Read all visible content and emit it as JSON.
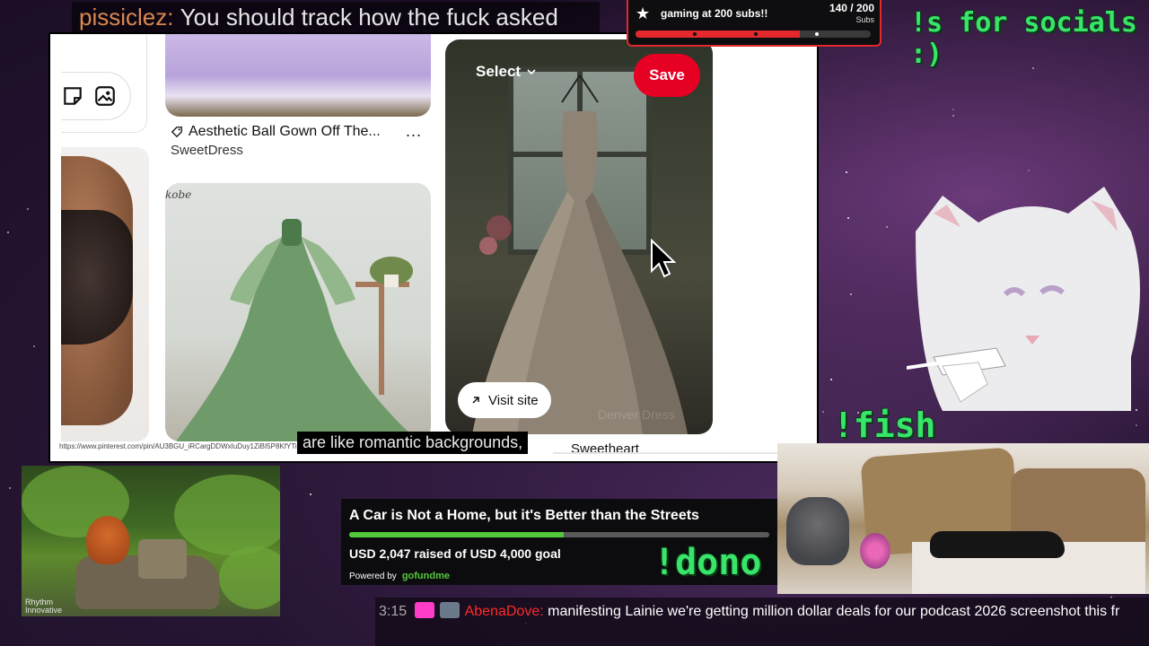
{
  "top_chat": {
    "user": "pissiclez:",
    "message": "You should track how the fuck asked"
  },
  "subs_goal": {
    "title": "gaming at 200 subs!!",
    "count": "140 / 200",
    "label": "Subs",
    "progress": 0.7,
    "accent": "#e3282e"
  },
  "overlays": {
    "socials": "!s for socials :)",
    "fish": "!fish",
    "dono": "!dono"
  },
  "pinterest": {
    "pin1_title": "Aesthetic Ball Gown Off The...",
    "pin1_more": "...",
    "pin1_source": "SweetDress",
    "pin2_brand": "kobe",
    "pin3_select": "Select",
    "pin3_save": "Save",
    "pin3_visit": "Visit site",
    "pin3_watermark": "Denver Dress",
    "next_title": "Sweetheart",
    "url": "https://www.pinterest.com/pin/AU3BGU_iRCargDDWxIuDuy1ZiBI5P8KfYTiG7B",
    "save_color": "#e60023"
  },
  "caption": "are like romantic backgrounds,",
  "donation": {
    "title": "A Car is Not a Home, but it's Better than the Streets",
    "raised": "USD 2,047 raised of USD 4,000 goal",
    "progress": 0.51175,
    "powered_by": "Powered by",
    "platform": "gofundme",
    "accent": "#52c93a"
  },
  "nature_video": {
    "tag_line1": "Rhythm",
    "tag_line2": "Innovative"
  },
  "bottom_chat": {
    "time": "3:15",
    "user": "AbenaDove:",
    "message": "manifesting Lainie we're getting million dollar deals for our podcast 2026 screenshot this fr"
  }
}
